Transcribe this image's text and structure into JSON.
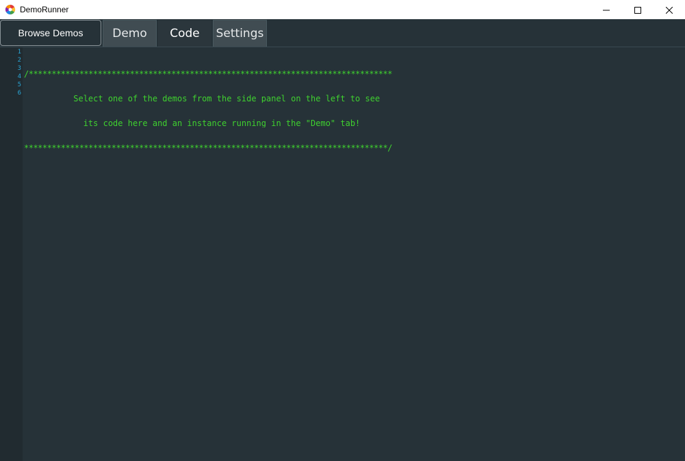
{
  "window": {
    "title": "DemoRunner",
    "icons": {
      "app": "app-logo-icon",
      "minimize": "minimize-icon",
      "maximize": "maximize-icon",
      "close": "close-icon"
    }
  },
  "tabs": {
    "browse_label": "Browse Demos",
    "items": [
      {
        "label": "Demo"
      },
      {
        "label": "Code"
      },
      {
        "label": "Settings"
      }
    ],
    "selected": "Code"
  },
  "editor": {
    "line_numbers": [
      "1",
      "2",
      "3",
      "4",
      "5",
      "6"
    ],
    "lines": [
      "",
      "/*******************************************************************************",
      "          Select one of the demos from the side panel on the left to see",
      "            its code here and an instance running in the \"Demo\" tab!",
      "*******************************************************************************/",
      ""
    ],
    "colors": {
      "background": "#263238",
      "gutter": "#212b30",
      "line_number": "#2aa6d6",
      "comment": "#3fd12f"
    }
  }
}
